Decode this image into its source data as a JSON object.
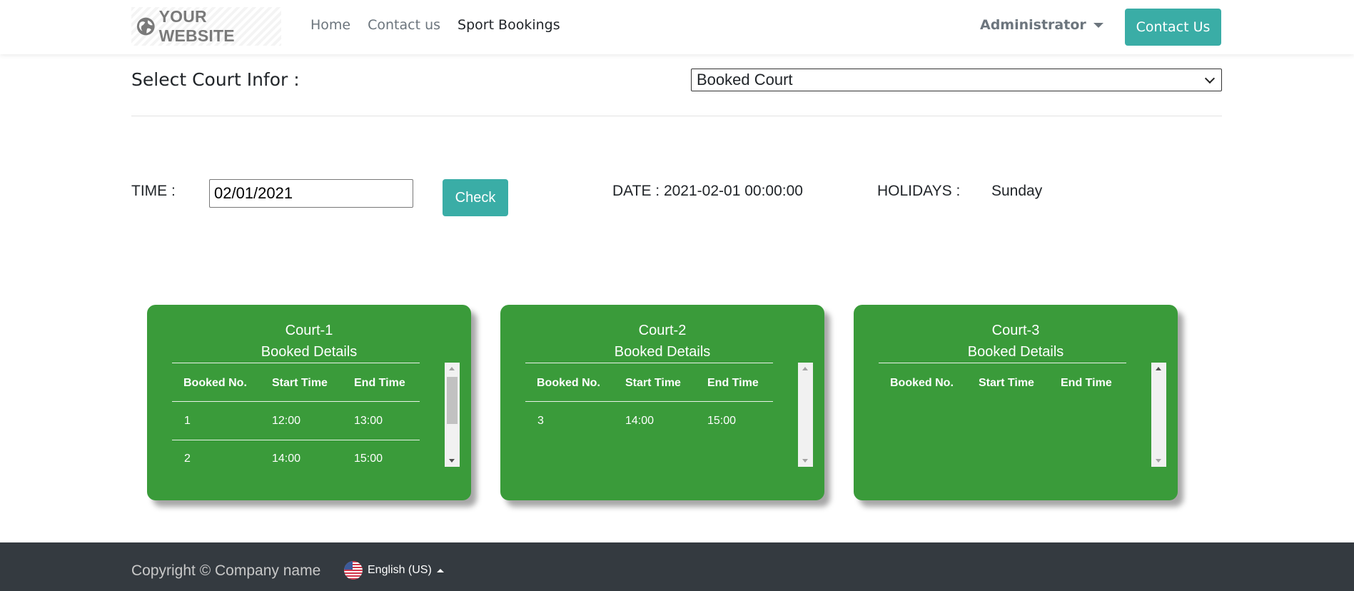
{
  "header": {
    "logo_text": "YOUR WEBSITE",
    "logo_icon": "globe-icon",
    "nav": [
      "Home",
      "Contact us",
      "Sport Bookings"
    ],
    "active_nav": "Sport Bookings",
    "user_menu": "Administrator",
    "contact_button": "Contact Us"
  },
  "court_select": {
    "label": "Select Court Infor :",
    "selected": "Booked Court"
  },
  "time_row": {
    "time_label": "TIME :",
    "date_value": "02/01/2021",
    "check_button": "Check",
    "date_text": "DATE : 2021-02-01 00:00:00",
    "holidays_label": "HOLIDAYS :",
    "holidays_value": "Sunday"
  },
  "courts": [
    {
      "name": "Court-1",
      "subtitle": "Booked Details",
      "headers": [
        "Booked No.",
        "Start Time",
        "End Time"
      ],
      "rows": [
        [
          "1",
          "12:00",
          "13:00"
        ],
        [
          "2",
          "14:00",
          "15:00"
        ]
      ]
    },
    {
      "name": "Court-2",
      "subtitle": "Booked Details",
      "headers": [
        "Booked No.",
        "Start Time",
        "End Time"
      ],
      "rows": [
        [
          "3",
          "14:00",
          "15:00"
        ]
      ]
    },
    {
      "name": "Court-3",
      "subtitle": "Booked Details",
      "headers": [
        "Booked No.",
        "Start Time",
        "End Time"
      ],
      "rows": []
    }
  ],
  "footer": {
    "copyright": "Copyright © Company name",
    "language": "English (US)",
    "flag_icon": "us-flag-icon"
  },
  "colors": {
    "accent": "#3aada6",
    "card_green": "#3a9b3a",
    "footer_bg": "#343a40"
  }
}
